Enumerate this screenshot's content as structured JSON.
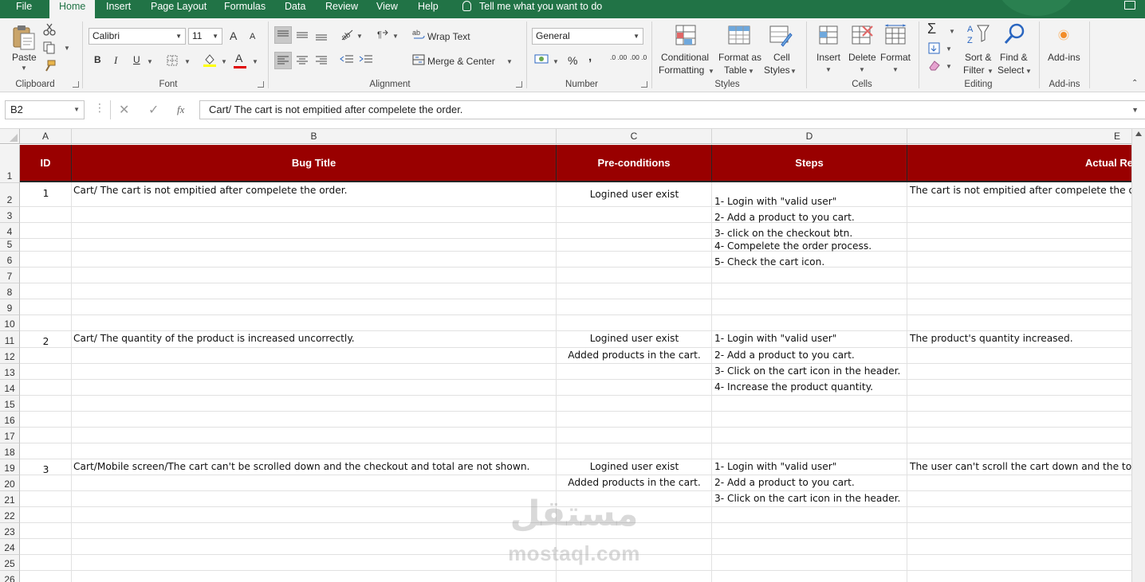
{
  "ribbon_tabs": [
    {
      "label": "File"
    },
    {
      "label": "Home"
    },
    {
      "label": "Insert"
    },
    {
      "label": "Page Layout"
    },
    {
      "label": "Formulas"
    },
    {
      "label": "Data"
    },
    {
      "label": "Review"
    },
    {
      "label": "View"
    },
    {
      "label": "Help"
    }
  ],
  "active_tab": "Home",
  "tell_me": "Tell me what you want to do",
  "clipboard": {
    "paste_label": "Paste",
    "group_label": "Clipboard"
  },
  "font": {
    "name": "Calibri",
    "size": "11",
    "bold": "B",
    "italic": "I",
    "underline": "U",
    "grow": "A",
    "shrink": "A",
    "font_color_glyph": "A",
    "group_label": "Font"
  },
  "alignment": {
    "wrap_text": "Wrap Text",
    "merge_center": "Merge & Center",
    "group_label": "Alignment"
  },
  "number": {
    "format": "General",
    "percent": "%",
    "comma": ",",
    "inc_dec": ".0 .00",
    "dec_dec": ".00 .0",
    "group_label": "Number"
  },
  "styles": {
    "conditional_1": "Conditional",
    "conditional_2": "Formatting",
    "format_table_1": "Format as",
    "format_table_2": "Table",
    "cell_styles_1": "Cell",
    "cell_styles_2": "Styles",
    "group_label": "Styles"
  },
  "cells": {
    "insert": "Insert",
    "delete": "Delete",
    "format": "Format",
    "group_label": "Cells"
  },
  "editing": {
    "sort_1": "Sort &",
    "sort_2": "Filter",
    "find_1": "Find &",
    "find_2": "Select",
    "group_label": "Editing"
  },
  "addins": {
    "label": "Add-ins",
    "group_label": "Add-ins"
  },
  "formula_bar": {
    "name_box": "B2",
    "fx": "fx",
    "content": "Cart/ The cart is not empitied after compelete the order."
  },
  "columns": [
    "A",
    "B",
    "C",
    "D",
    "E"
  ],
  "rows": [
    "1",
    "2",
    "3",
    "4",
    "5",
    "6",
    "7",
    "8",
    "9",
    "10",
    "11",
    "12",
    "13",
    "14",
    "15",
    "16",
    "17",
    "18",
    "19",
    "20",
    "21",
    "22",
    "23",
    "24",
    "25",
    "26"
  ],
  "headers": {
    "id": "ID",
    "bug_title": "Bug Title",
    "pre_conditions": "Pre-conditions",
    "steps": "Steps",
    "actual": "Actual Re"
  },
  "bugs": [
    {
      "id": "1",
      "title": "Cart/ The cart is not empitied after compelete the order.",
      "pre": [
        "Logined user exist"
      ],
      "steps": [
        "1- Login with \"valid user\"",
        "2- Add a product to you cart.",
        "3- click on the checkout btn.",
        "4- Compelete the order process.",
        "5- Check the cart icon."
      ],
      "actual": "The cart is not empitied after compelete the o"
    },
    {
      "id": "2",
      "title": "Cart/ The quantity of the product is increased uncorrectly.",
      "pre": [
        "Logined user exist",
        "Added products in the cart."
      ],
      "steps": [
        "1- Login with \"valid user\"",
        "2- Add a product to you cart.",
        "3- Click on the cart icon in the header.",
        "4- Increase the product quantity."
      ],
      "actual": "The product's quantity increased."
    },
    {
      "id": "3",
      "title": "Cart/Mobile screen/The cart can't be scrolled down and the checkout and total are not shown.",
      "pre": [
        "Logined user exist",
        "Added products in the cart."
      ],
      "steps": [
        "1- Login with \"valid user\"",
        "2- Add a product to you cart.",
        "3- Click on the cart icon in the header."
      ],
      "actual": "The user can't scroll the cart down and the tot"
    }
  ],
  "watermark": {
    "arabic": "مستقل",
    "latin": "mostaql.com"
  },
  "accent_color": "#217346",
  "header_fill": "#990000"
}
